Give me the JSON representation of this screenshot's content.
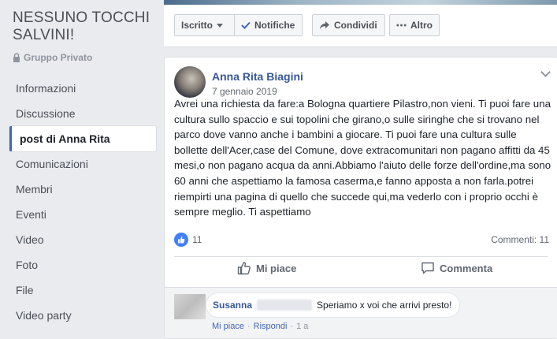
{
  "group": {
    "name": "NESSUNO TOCCHI SALVINI!",
    "type": "Gruppo Privato"
  },
  "nav": {
    "items": [
      {
        "label": "Informazioni"
      },
      {
        "label": "Discussione"
      },
      {
        "label": "post di Anna Rita"
      },
      {
        "label": "Comunicazioni"
      },
      {
        "label": "Membri"
      },
      {
        "label": "Eventi"
      },
      {
        "label": "Video"
      },
      {
        "label": "Foto"
      },
      {
        "label": "File"
      },
      {
        "label": "Video party"
      }
    ],
    "active": "post di Anna Rita"
  },
  "actions": {
    "iscritto": "Iscritto",
    "notifiche": "Notifiche",
    "condividi": "Condividi",
    "altro": "Altro"
  },
  "post": {
    "author": "Anna Rita Biagini",
    "date": "7 gennaio 2019",
    "text": "Avrei una richiesta da fare:a Bologna quartiere Pilastro,non vieni. Ti puoi fare una cultura sullo spaccio e sui topolini che girano,o sulle siringhe che si trovano nel parco dove vanno anche i bambini a giocare. Ti puoi fare una cultura sulle bollette dell'Acer,case del Comune, dove extracomunitari non pagano affitti da 45 mesi,o non pagano acqua da anni.Abbiamo l'aiuto delle forze dell'ordine,ma sono 60 anni che aspettiamo la famosa caserma,e fanno apposta a non farla.potrei riempirti una pagina di quello che succede qui,ma vederlo con i proprio occhi è sempre meglio. Ti aspettiamo",
    "likes": "11",
    "comments_label": "Commenti: 11",
    "like_button": "Mi piace",
    "comment_button": "Commenta"
  },
  "comment": {
    "name": "Susanna",
    "text": "Speriamo x voi che arrivi presto!",
    "like": "Mi piace",
    "reply": "Rispondi",
    "separator": "·",
    "time": "1 a"
  },
  "colors": {
    "accent": "#4267b2",
    "link": "#385898",
    "background": "#e9ebee"
  }
}
